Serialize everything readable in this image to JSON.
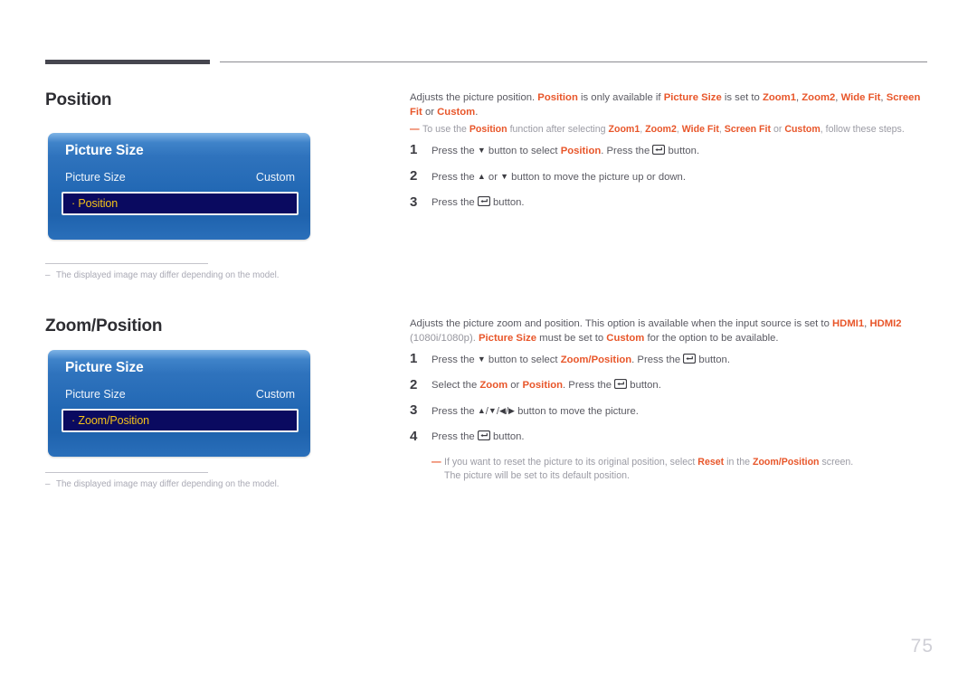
{
  "page": {
    "number": "75"
  },
  "sections": [
    {
      "heading": "Position",
      "osd": {
        "title": "Picture Size",
        "row_label": "Picture Size",
        "row_value": "Custom",
        "highlight": "· Position"
      },
      "footnote": "The displayed image may differ depending on the model.",
      "footnote_dash": "–",
      "intro": {
        "t1": "Adjusts the picture position. ",
        "b1": "Position",
        "t2": " is only available if ",
        "b2": "Picture Size",
        "t3": " is set to ",
        "b3": "Zoom1",
        "t4": ", ",
        "b4": "Zoom2",
        "t5": ", ",
        "b5": "Wide Fit",
        "t6": ", ",
        "b6": "Screen Fit",
        "t7": " or ",
        "b7": "Custom",
        "t8": "."
      },
      "note": {
        "lead": "—",
        "t1": "To use the ",
        "b1": "Position",
        "t2": " function after selecting ",
        "b2": "Zoom1",
        "t3": ", ",
        "b3": "Zoom2",
        "t4": ", ",
        "b4": "Wide Fit",
        "t5": ", ",
        "b5": "Screen Fit",
        "t6": " or ",
        "b6": "Custom",
        "t7": ", follow these steps."
      },
      "steps": [
        {
          "num": "1",
          "t1": "Press the ",
          "icon1": "down-triangle",
          "t2": " button to select ",
          "b1": "Position",
          "t3": ". Press the ",
          "icon2": "enter-button",
          "t4": " button."
        },
        {
          "num": "2",
          "t1": "Press the ",
          "icon1": "up-triangle",
          "t2": " or ",
          "icon2": "down-triangle",
          "t3": " button to move the picture up or down."
        },
        {
          "num": "3",
          "t1": "Press the ",
          "icon1": "enter-button",
          "t2": " button."
        }
      ]
    },
    {
      "heading": "Zoom/Position",
      "osd": {
        "title": "Picture Size",
        "row_label": "Picture Size",
        "row_value": "Custom",
        "highlight": "· Zoom/Position"
      },
      "footnote": "The displayed image may differ depending on the model.",
      "footnote_dash": "–",
      "intro": {
        "t1": "Adjusts the picture zoom and position. This option is available when the input source is set to ",
        "b1": "HDMI1",
        "t2": ", ",
        "b2": "HDMI2",
        "t3": " (1080i/1080p). ",
        "b3": "Picture Size",
        "t4": " must be set to ",
        "b4": "Custom",
        "t5": " for the option to be available."
      },
      "steps": [
        {
          "num": "1",
          "t1": "Press the ",
          "icon1": "down-triangle",
          "t2": " button to select ",
          "b1": "Zoom/Position",
          "t3": ". Press the ",
          "icon2": "enter-button",
          "t4": " button."
        },
        {
          "num": "2",
          "t1": "Select the ",
          "b1": "Zoom",
          "t2": " or ",
          "b2": "Position",
          "t3": ". Press the ",
          "icon2": "enter-button",
          "t4": " button."
        },
        {
          "num": "3",
          "t1": "Press the ",
          "icons": "up/down/left/right-triangles",
          "t2": " button to move the picture."
        },
        {
          "num": "4",
          "t1": "Press the ",
          "icon1": "enter-button",
          "t2": " button."
        }
      ],
      "reset_note": {
        "lead": "—",
        "t1": "If you want to reset the picture to its original position, select ",
        "b1": "Reset",
        "t2": " in the ",
        "b2": "Zoom/Position",
        "t3": " screen.",
        "t4": "The picture will be set to its default position."
      }
    }
  ],
  "colors": {
    "accent_orange": "#e8562a",
    "osd_blue": "#2268b4",
    "osd_highlight_navy": "#0a0a60",
    "osd_highlight_text": "#f5c319",
    "rule_dark": "#46464f"
  }
}
